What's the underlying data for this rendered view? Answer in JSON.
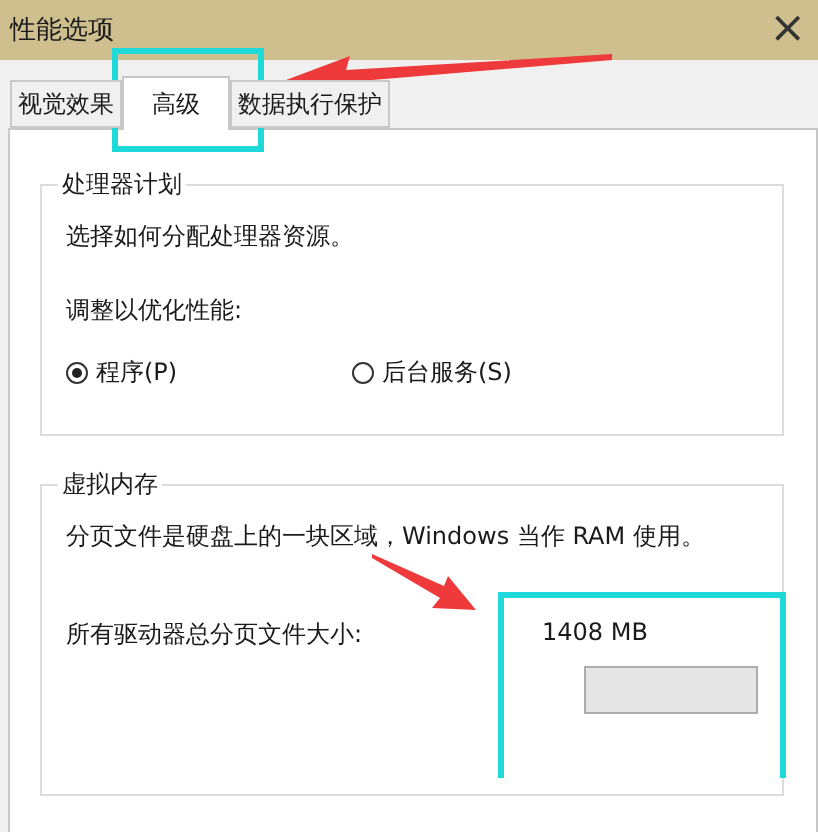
{
  "window": {
    "title": "性能选项",
    "close": "×"
  },
  "tabs": [
    {
      "label": "视觉效果",
      "selected": false
    },
    {
      "label": "高级",
      "selected": true
    },
    {
      "label": "数据执行保护",
      "selected": false
    }
  ],
  "processor": {
    "title": "处理器计划",
    "description": "选择如何分配处理器资源。",
    "prompt": "调整以优化性能:",
    "options": [
      {
        "label": "程序(P)",
        "selected": true
      },
      {
        "label": "后台服务(S)",
        "selected": false
      }
    ]
  },
  "virtual_memory": {
    "title": "虚拟内存",
    "description": "分页文件是硬盘上的一块区域，Windows 当作 RAM 使用。",
    "size_label": "所有驱动器总分页文件大小:",
    "size_value": "1408 MB"
  }
}
